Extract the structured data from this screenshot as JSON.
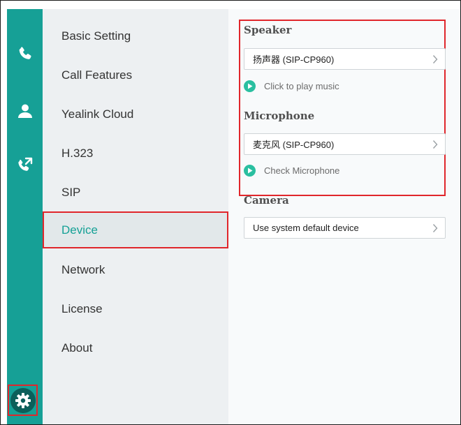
{
  "menu": {
    "items": [
      {
        "label": "Basic Setting"
      },
      {
        "label": "Call Features"
      },
      {
        "label": "Yealink Cloud"
      },
      {
        "label": "H.323"
      },
      {
        "label": "SIP"
      },
      {
        "label": "Device"
      },
      {
        "label": "Network"
      },
      {
        "label": "License"
      },
      {
        "label": "About"
      }
    ],
    "active": "Device"
  },
  "rail": {
    "icons": [
      "phone-icon",
      "contacts-icon",
      "call-history-icon",
      "settings-icon"
    ]
  },
  "device": {
    "speaker": {
      "heading": "Speaker",
      "value": "扬声器 (SIP-CP960)",
      "action": "Click to play music"
    },
    "microphone": {
      "heading": "Microphone",
      "value": "麦克风 (SIP-CP960)",
      "action": "Check Microphone"
    },
    "camera": {
      "heading": "Camera",
      "value": "Use system default device"
    }
  },
  "colors": {
    "rail": "#16a096",
    "accent": "#15a196",
    "highlight_border": "#e0262b",
    "play_button": "#2abfa0"
  }
}
